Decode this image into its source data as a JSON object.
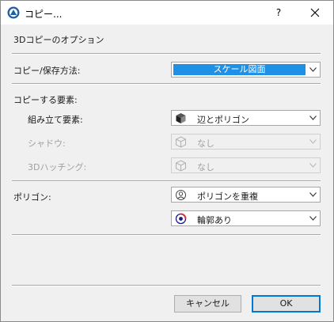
{
  "window": {
    "title": "コピー...",
    "help_label": "?"
  },
  "section_title": "3Dコピーのオプション",
  "copy_method": {
    "label": "コピー/保存方法:",
    "value": "スケール図面"
  },
  "elements": {
    "header": "コピーする要素:",
    "rows": [
      {
        "label": "組み立て要素:",
        "value": "辺とポリゴン",
        "icon": "cube-solid-icon",
        "disabled": false
      },
      {
        "label": "シャドウ:",
        "value": "なし",
        "icon": "cube-outline-icon",
        "disabled": true
      },
      {
        "label": "3Dハッチング:",
        "value": "なし",
        "icon": "cube-outline-icon",
        "disabled": true
      }
    ]
  },
  "polygon": {
    "label": "ポリゴン:",
    "value": "ポリゴンを重複",
    "icon": "polygon-overlap-icon",
    "outline_value": "輪郭あり",
    "outline_icon": "outline-icon"
  },
  "buttons": {
    "cancel": "キャンセル",
    "ok": "OK"
  },
  "colors": {
    "accent": "#1e90e6",
    "default_button_border": "#0078d7"
  }
}
